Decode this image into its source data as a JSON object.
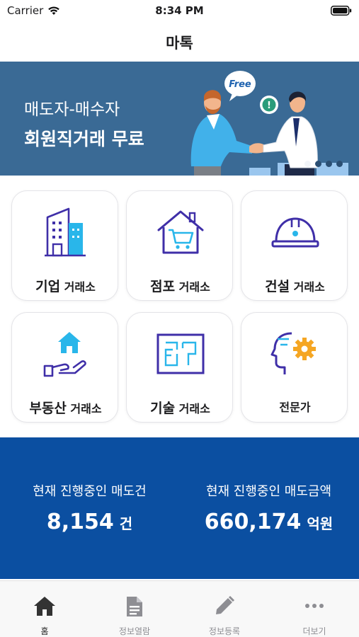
{
  "status_bar": {
    "carrier": "Carrier",
    "time": "8:34 PM"
  },
  "header": {
    "title": "마톡"
  },
  "banner": {
    "subtitle": "매도자-매수자",
    "title": "회원직거래 무료",
    "bubble_text": "Free",
    "bubble_mark": "!",
    "page_count": 4,
    "active_page": 0
  },
  "categories": [
    {
      "bold": "기업",
      "suffix": " 거래소",
      "icon": "building-icon"
    },
    {
      "bold": "점포",
      "suffix": " 거래소",
      "icon": "store-cart-icon"
    },
    {
      "bold": "건설",
      "suffix": " 거래소",
      "icon": "hard-hat-icon"
    },
    {
      "bold": "부동산",
      "suffix": " 거래소",
      "icon": "house-hand-icon"
    },
    {
      "bold": "기술",
      "suffix": " 거래소",
      "icon": "blueprint-icon"
    },
    {
      "bold": "",
      "suffix": "전문가",
      "icon": "expert-gear-icon"
    }
  ],
  "stats": {
    "listings_label": "현재 진행중인 매도건",
    "listings_value": "8,154",
    "listings_unit": "건",
    "amount_label": "현재 진행중인 매도금액",
    "amount_value": "660,174",
    "amount_unit": "억원"
  },
  "tabs": [
    {
      "label": "홈",
      "icon": "home-icon",
      "active": true
    },
    {
      "label": "정보열람",
      "icon": "document-icon",
      "active": false
    },
    {
      "label": "정보등록",
      "icon": "pencil-icon",
      "active": false
    },
    {
      "label": "더보기",
      "icon": "more-dots-icon",
      "active": false
    }
  ],
  "colors": {
    "banner_bg": "#3a6a95",
    "stats_bg": "#0b4fa1",
    "icon_purple": "#3f2fa8",
    "icon_cyan": "#29b6ea",
    "icon_orange": "#f5a623"
  }
}
